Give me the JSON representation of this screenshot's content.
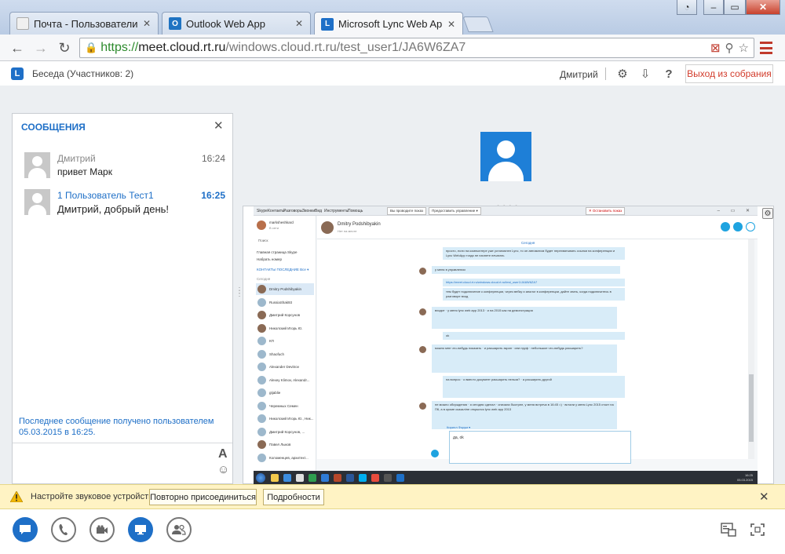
{
  "browser": {
    "tabs": [
      {
        "label": "Почта - Пользователи",
        "icon": "mail-tab-icon"
      },
      {
        "label": "Outlook Web App",
        "icon": "outlook-icon"
      },
      {
        "label": "Microsoft Lync Web App",
        "icon": "lync-icon"
      }
    ],
    "url": {
      "scheme": "https://",
      "host": "meet.cloud.rt.ru",
      "path": "/windows.cloud.rt.ru/test_user1/JA6W6ZA7"
    }
  },
  "header": {
    "conversation_title": "Беседа (Участников: 2)",
    "user_name": "Дмитрий",
    "exit_button": "Выход из собрания"
  },
  "messages_panel": {
    "title": "СООБЩЕНИЯ",
    "messages": [
      {
        "sender": "Дмитрий",
        "time": "16:24",
        "text": "привет Марк"
      },
      {
        "sender": "1 Пользователь Тест1",
        "time": "16:25",
        "text": "Дмитрий, добрый день!"
      }
    ],
    "notice": "Последнее сообщение получено пользователем 05.03.2015 в 16:25."
  },
  "shared_screen": {
    "menu": [
      "Skype",
      "Контакты",
      "Разговоры",
      "Звонки",
      "Вид",
      "Инструменты",
      "Помощь"
    ],
    "sharebar": [
      "Вы проводите показ",
      "Предоставить управление ▾",
      "✕ Остановить показ"
    ],
    "me": {
      "name": "marksheshkard",
      "status": "В сети"
    },
    "search": "Поиск",
    "nav": [
      "Главная страница Skype",
      "Набрать номер"
    ],
    "tabs": "КОНТАКТЫ   ПОСЛЕДНИЕ   Все ▾",
    "contacts_header": "Сегодня",
    "contacts": [
      "Dmitry Podshibyakin",
      "RussiaShak93",
      "Дмитрий Корсунов",
      "Николский Игорь Ю.",
      "КП",
      "Shaofuch",
      "Alexander Devitrov",
      "Alexey Klimov, Alexandr...",
      "gtjablie",
      "Черемных Семен",
      "Николский Игорь Ю., Ник...",
      "Дмитрий Корсунов, ...",
      "Павел Лыков",
      "Коломенцев, архитект..."
    ],
    "chat_contact": {
      "name": "Dmitry Podshibyakin",
      "status": "Нет на месте"
    },
    "today_label": "Сегодня",
    "bubbles": [
      "просто, если на компьютере уже установлен Lync, то он автоматом будет перехватывать ссылки на конференции и Lync WebApp тогда не начнете печатать",
      "у меня в управлении",
      "https://meet.cloud.rt.ru/windows.cloud.rt.ru/test_user1/JA6W6ZA7",
      "тем будет подключение к конференции, через вебку и аналог в конференции, дайте знать, когда подключитесь   в разговоре вход",
      "входит · у меня lync web app 2013 · и на 2015 как на демонстрация",
      "ok",
      "можно мне что-нибудь показать · и расшарить экран · или пруф · небольшое что-нибудь расшарить?",
      "на вопрос · о вместо документ расшарить нельзя? · а расширить другой",
      "не можно обсуждения · я сегодня сделал · сначала быстрее, у меня встреча в 16:45 =) · встали у меня Lync 2015 стоит на ПК, а в кроме сказал/не открылся lync web app 2013"
    ],
    "compose_label": "Кирилл Форум ▾",
    "compose_text": "да, ok",
    "clock": {
      "time": "16:25",
      "date": "05.03.2015"
    }
  },
  "notification": {
    "text": "Настройте звуковое устройство.",
    "reconnect_button": "Повторно присоединиться",
    "details_button": "Подробности"
  },
  "colors": {
    "accent": "#1e6fc7",
    "exit_red": "#d23c2c",
    "notification_bg": "#fff3c4",
    "stage_bg": "#eceff2"
  }
}
